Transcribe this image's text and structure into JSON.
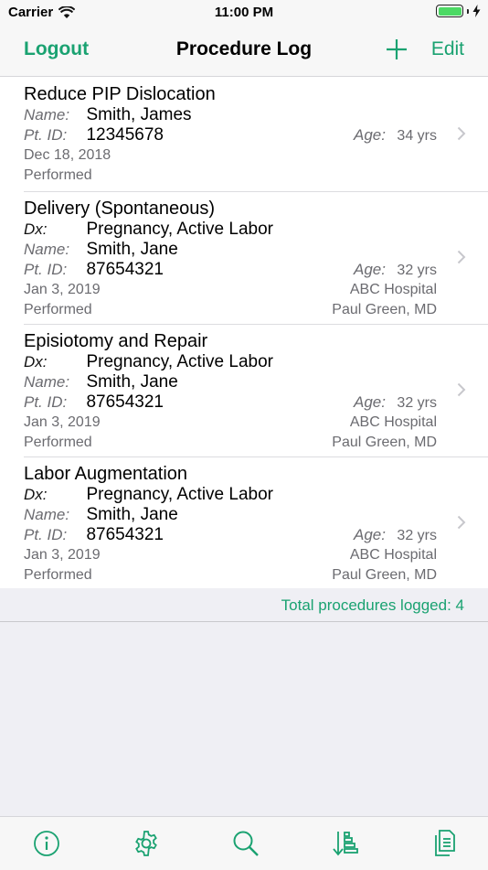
{
  "status_bar": {
    "carrier": "Carrier",
    "time": "11:00 PM"
  },
  "nav": {
    "left_label": "Logout",
    "title": "Procedure Log",
    "right_label": "Edit"
  },
  "labels": {
    "dx": "Dx:",
    "name": "Name:",
    "pt_id": "Pt. ID:",
    "age": "Age:"
  },
  "procedures": [
    {
      "title": "Reduce PIP Dislocation",
      "name": "Smith, James",
      "pt_id": "12345678",
      "age": "34 yrs",
      "date": "Dec 18, 2018",
      "status": "Performed"
    },
    {
      "title": "Delivery (Spontaneous)",
      "dx": "Pregnancy, Active Labor",
      "name": "Smith, Jane",
      "pt_id": "87654321",
      "age": "32 yrs",
      "date": "Jan 3, 2019",
      "location": "ABC Hospital",
      "status": "Performed",
      "provider": "Paul Green, MD"
    },
    {
      "title": "Episiotomy and Repair",
      "dx": "Pregnancy, Active Labor",
      "name": "Smith, Jane",
      "pt_id": "87654321",
      "age": "32 yrs",
      "date": "Jan 3, 2019",
      "location": "ABC Hospital",
      "status": "Performed",
      "provider": "Paul Green, MD"
    },
    {
      "title": "Labor Augmentation",
      "dx": "Pregnancy, Active Labor",
      "name": "Smith, Jane",
      "pt_id": "87654321",
      "age": "32 yrs",
      "date": "Jan 3, 2019",
      "location": "ABC Hospital",
      "status": "Performed",
      "provider": "Paul Green, MD"
    }
  ],
  "footer": {
    "total": "Total procedures logged:  4"
  },
  "tab_bar": {
    "icons": [
      "info-icon",
      "gear-icon",
      "search-icon",
      "sort-icon",
      "documents-icon"
    ]
  },
  "colors": {
    "accent": "#1aa271",
    "background": "#efeff4",
    "secondary_text": "#6b6b70"
  }
}
